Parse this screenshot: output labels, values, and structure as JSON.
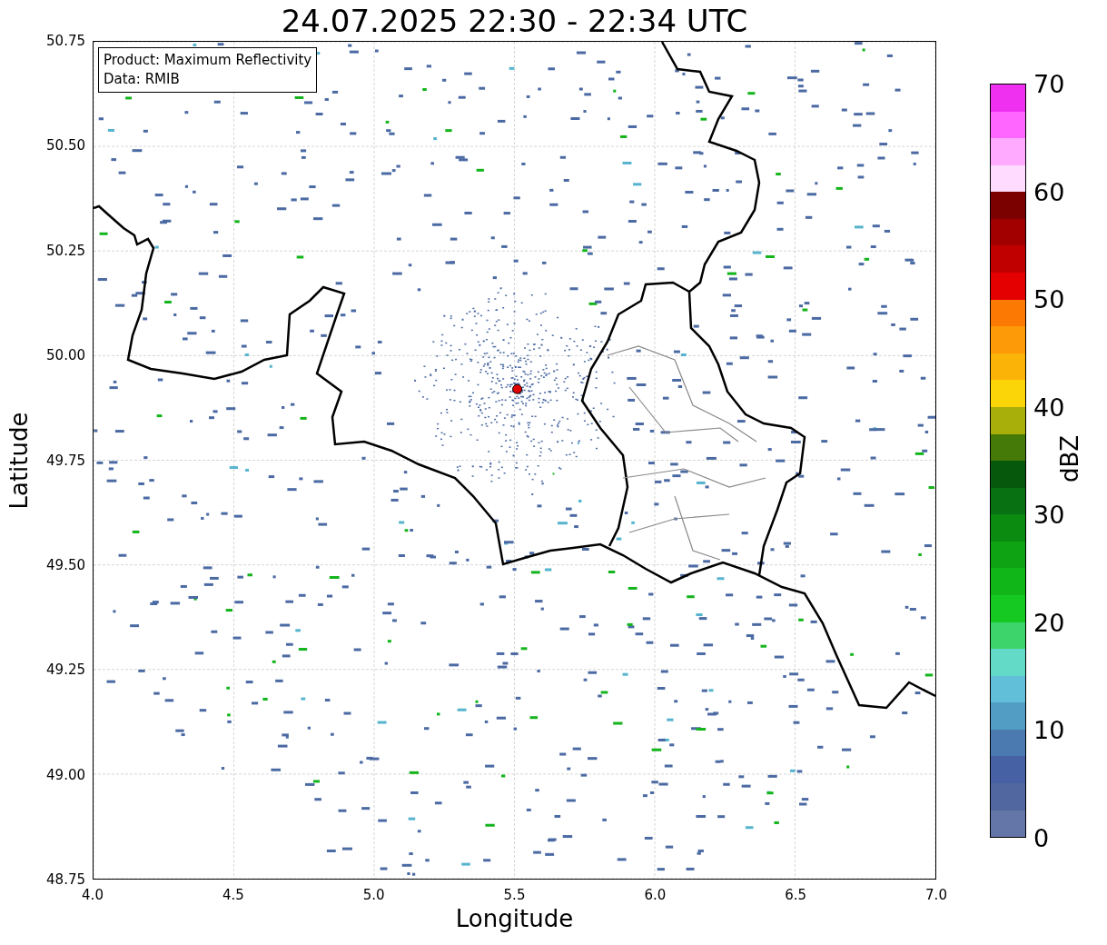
{
  "title": "24.07.2025 22:30 - 22:34 UTC",
  "legend": {
    "lines": [
      "Product: Maximum Reflectivity",
      "Data: RMIB"
    ]
  },
  "x_axis": {
    "label": "Longitude",
    "ticks": [
      "4.0",
      "4.5",
      "5.0",
      "5.5",
      "6.0",
      "6.5",
      "7.0"
    ]
  },
  "y_axis": {
    "label": "Latitude",
    "ticks": [
      "50.75",
      "50.50",
      "50.25",
      "50.00",
      "49.75",
      "49.50",
      "49.25",
      "49.00",
      "48.75"
    ]
  },
  "colorbar": {
    "label": "dBZ",
    "ticks": [
      "70",
      "60",
      "50",
      "40",
      "30",
      "20",
      "10",
      "0"
    ],
    "bins": [
      {
        "color": "#f030f0"
      },
      {
        "color": "#ff66ff"
      },
      {
        "color": "#ffaaff"
      },
      {
        "color": "#ffdcff"
      },
      {
        "color": "#7b0000"
      },
      {
        "color": "#a20000"
      },
      {
        "color": "#c00000"
      },
      {
        "color": "#e40000"
      },
      {
        "color": "#fc7a04"
      },
      {
        "color": "#fc9a08"
      },
      {
        "color": "#fcb308"
      },
      {
        "color": "#fcd508"
      },
      {
        "color": "#a8ae0a"
      },
      {
        "color": "#467a08"
      },
      {
        "color": "#05580c"
      },
      {
        "color": "#087212"
      },
      {
        "color": "#0b8b10"
      },
      {
        "color": "#0ea313"
      },
      {
        "color": "#10b518"
      },
      {
        "color": "#16c822"
      },
      {
        "color": "#3dd46b"
      },
      {
        "color": "#63d9c7"
      },
      {
        "color": "#62bfd9"
      },
      {
        "color": "#519dc3"
      },
      {
        "color": "#4a7ab0"
      },
      {
        "color": "#4661a4"
      },
      {
        "color": "#51679f"
      },
      {
        "color": "#6475a8"
      }
    ]
  }
}
